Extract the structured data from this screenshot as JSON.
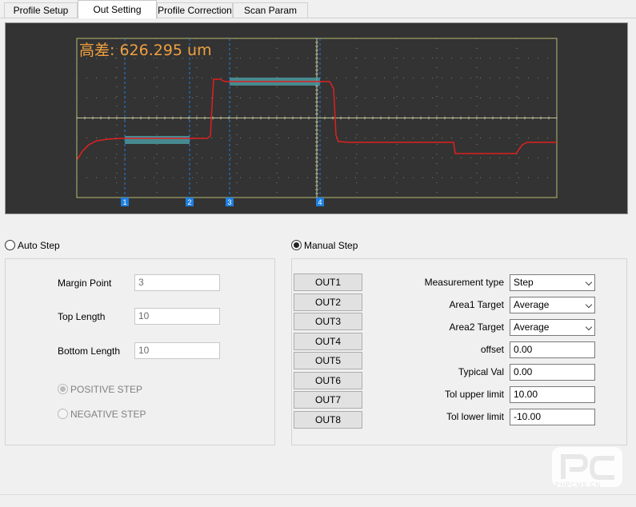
{
  "tabs": [
    {
      "label": "Profile Setup"
    },
    {
      "label": "Out Setting"
    },
    {
      "label": "Profile Correction"
    },
    {
      "label": "Scan Param"
    }
  ],
  "active_tab": "Out Setting",
  "scope": {
    "readout": "高差: 626.295 um",
    "readout_color": "#f0a040",
    "profile_color": "#e02020",
    "area_color": "#4a9aa0",
    "marker_color": "#1e7fe0",
    "markers": [
      {
        "label": "1"
      },
      {
        "label": "2"
      },
      {
        "label": "3"
      },
      {
        "label": "4"
      }
    ]
  },
  "auto_step": {
    "label": "Auto Step",
    "selected": false,
    "margin_point_label": "Margin Point",
    "margin_point_value": "3",
    "top_length_label": "Top Length",
    "top_length_value": "10",
    "bottom_length_label": "Bottom Length",
    "bottom_length_value": "10",
    "positive_label": "POSITIVE STEP",
    "positive_selected": true,
    "negative_label": "NEGATIVE STEP",
    "negative_selected": false
  },
  "manual_step": {
    "label": "Manual Step",
    "selected": true,
    "outputs": [
      "OUT1",
      "OUT2",
      "OUT3",
      "OUT4",
      "OUT5",
      "OUT6",
      "OUT7",
      "OUT8"
    ],
    "measurement_type_label": "Measurement type",
    "measurement_type_value": "Step",
    "area1_label": "Area1  Target",
    "area1_value": "Average",
    "area2_label": "Area2  Target",
    "area2_value": "Average",
    "offset_label": "offset",
    "offset_value": "0.00",
    "typical_label": "Typical Val",
    "typical_value": "0.00",
    "upper_label": "Tol upper limit",
    "upper_value": "10.00",
    "lower_label": "Tol lower limit",
    "lower_value": "-10.00"
  },
  "watermark": {
    "text": "PHPCMS.CN"
  }
}
